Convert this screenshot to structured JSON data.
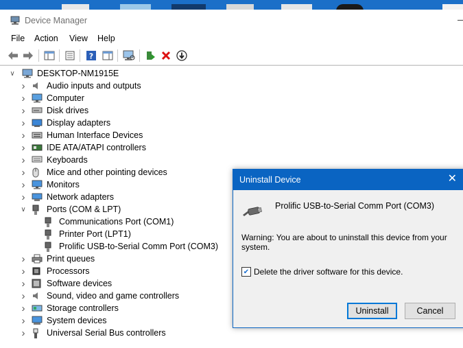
{
  "window": {
    "title": "Device Manager"
  },
  "menu": [
    "File",
    "Action",
    "View",
    "Help"
  ],
  "toolbar": {
    "buttons": [
      "back-icon",
      "forward-icon",
      "properties-icon",
      "show-hide-console-tree-icon",
      "help-icon",
      "action-pane-icon",
      "scan-hardware-icon",
      "update-driver-icon",
      "uninstall-device-icon",
      "disable-device-icon"
    ]
  },
  "tree": {
    "root": "DESKTOP-NM1915E",
    "items": [
      {
        "label": "Audio inputs and outputs",
        "icon": "speaker-icon"
      },
      {
        "label": "Computer",
        "icon": "computer-icon"
      },
      {
        "label": "Disk drives",
        "icon": "disk-drive-icon"
      },
      {
        "label": "Display adapters",
        "icon": "display-adapter-icon"
      },
      {
        "label": "Human Interface Devices",
        "icon": "hid-icon"
      },
      {
        "label": "IDE ATA/ATAPI controllers",
        "icon": "ide-controller-icon"
      },
      {
        "label": "Keyboards",
        "icon": "keyboard-icon"
      },
      {
        "label": "Mice and other pointing devices",
        "icon": "mouse-icon"
      },
      {
        "label": "Monitors",
        "icon": "monitor-icon"
      },
      {
        "label": "Network adapters",
        "icon": "network-adapter-icon"
      },
      {
        "label": "Ports (COM & LPT)",
        "icon": "port-icon",
        "expanded": true,
        "children": [
          {
            "label": "Communications Port (COM1)",
            "icon": "port-icon"
          },
          {
            "label": "Printer Port (LPT1)",
            "icon": "port-icon"
          },
          {
            "label": "Prolific USB-to-Serial Comm Port (COM3)",
            "icon": "port-icon"
          }
        ]
      },
      {
        "label": "Print queues",
        "icon": "printer-icon"
      },
      {
        "label": "Processors",
        "icon": "processor-icon"
      },
      {
        "label": "Software devices",
        "icon": "software-device-icon"
      },
      {
        "label": "Sound, video and game controllers",
        "icon": "sound-controller-icon"
      },
      {
        "label": "Storage controllers",
        "icon": "storage-controller-icon"
      },
      {
        "label": "System devices",
        "icon": "system-device-icon"
      },
      {
        "label": "Universal Serial Bus controllers",
        "icon": "usb-icon"
      }
    ]
  },
  "dialog": {
    "title": "Uninstall Device",
    "device_name": "Prolific USB-to-Serial Comm Port (COM3)",
    "warning": "Warning: You are about to uninstall this device from your system.",
    "checkbox_label": "Delete the driver software for this device.",
    "checkbox_checked": true,
    "uninstall_label": "Uninstall",
    "cancel_label": "Cancel"
  },
  "colors": {
    "accent": "#0a64c2",
    "dialog_bg": "#f0f0f0"
  }
}
